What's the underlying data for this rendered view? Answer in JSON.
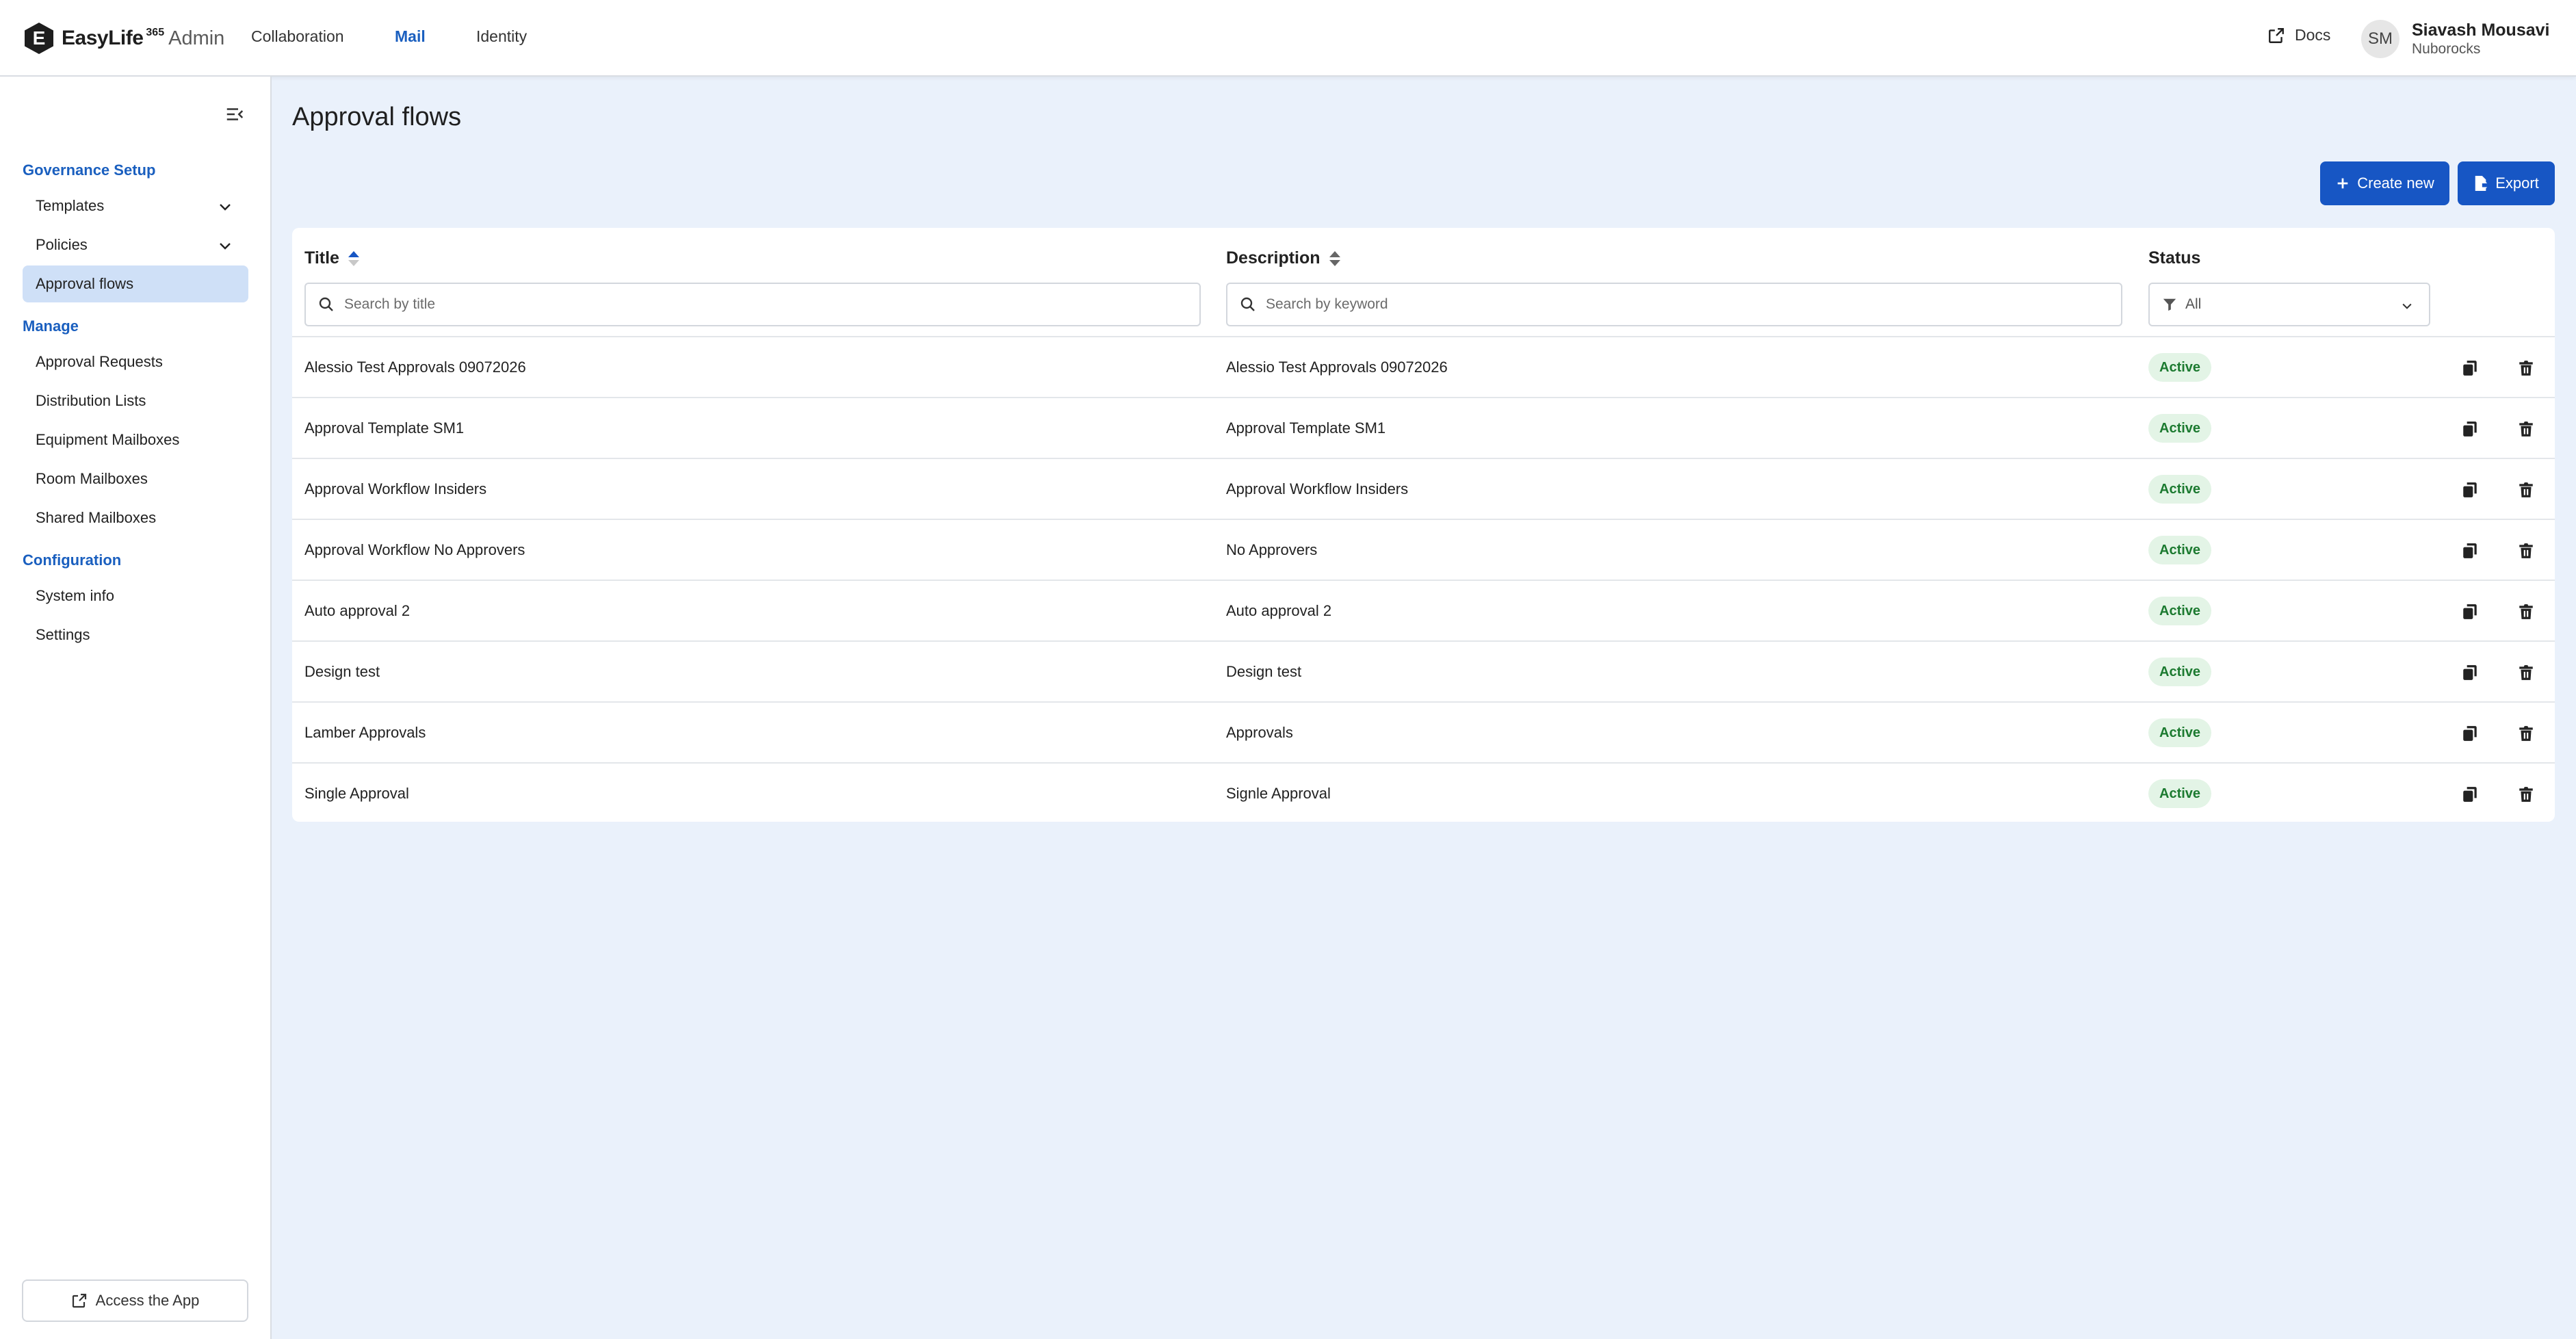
{
  "brand": {
    "initial": "E",
    "name": "EasyLife",
    "superscript": "365",
    "suffix": "Admin"
  },
  "topnav": [
    {
      "label": "Collaboration",
      "active": false
    },
    {
      "label": "Mail",
      "active": true
    },
    {
      "label": "Identity",
      "active": false
    }
  ],
  "header": {
    "docs_label": "Docs",
    "avatar_initials": "SM",
    "user_name": "Siavash Mousavi",
    "user_org": "Nuborocks"
  },
  "sidebar": {
    "sections": [
      {
        "title": "Governance Setup",
        "items": [
          {
            "label": "Templates",
            "expandable": true
          },
          {
            "label": "Policies",
            "expandable": true
          },
          {
            "label": "Approval flows",
            "active": true
          }
        ]
      },
      {
        "title": "Manage",
        "items": [
          {
            "label": "Approval Requests"
          },
          {
            "label": "Distribution Lists"
          },
          {
            "label": "Equipment Mailboxes"
          },
          {
            "label": "Room Mailboxes"
          },
          {
            "label": "Shared Mailboxes"
          }
        ]
      },
      {
        "title": "Configuration",
        "items": [
          {
            "label": "System info"
          },
          {
            "label": "Settings"
          }
        ]
      }
    ],
    "access_app_label": "Access the App"
  },
  "page": {
    "title": "Approval flows",
    "create_label": "Create new",
    "export_label": "Export"
  },
  "table": {
    "columns": {
      "title": "Title",
      "description": "Description",
      "status": "Status"
    },
    "filters": {
      "title_placeholder": "Search by title",
      "description_placeholder": "Search by keyword",
      "status_value": "All"
    },
    "rows": [
      {
        "title": "Alessio Test Approvals 09072026",
        "description": "Alessio Test Approvals 09072026",
        "status": "Active"
      },
      {
        "title": "Approval Template SM1",
        "description": "Approval Template SM1",
        "status": "Active"
      },
      {
        "title": "Approval Workflow Insiders",
        "description": "Approval Workflow Insiders",
        "status": "Active"
      },
      {
        "title": "Approval Workflow No Approvers",
        "description": "No Approvers",
        "status": "Active"
      },
      {
        "title": "Auto approval 2",
        "description": "Auto approval 2",
        "status": "Active"
      },
      {
        "title": "Design test",
        "description": "Design test",
        "status": "Active"
      },
      {
        "title": "Lamber Approvals",
        "description": "Approvals",
        "status": "Active"
      },
      {
        "title": "Single Approval",
        "description": "Signle Approval",
        "status": "Active"
      }
    ]
  },
  "colors": {
    "accent": "#1756c4",
    "active_nav": "#1a5fbf",
    "badge_bg": "#e3f4e6",
    "badge_text": "#1c7a30",
    "page_bg": "#eaf1fb"
  }
}
